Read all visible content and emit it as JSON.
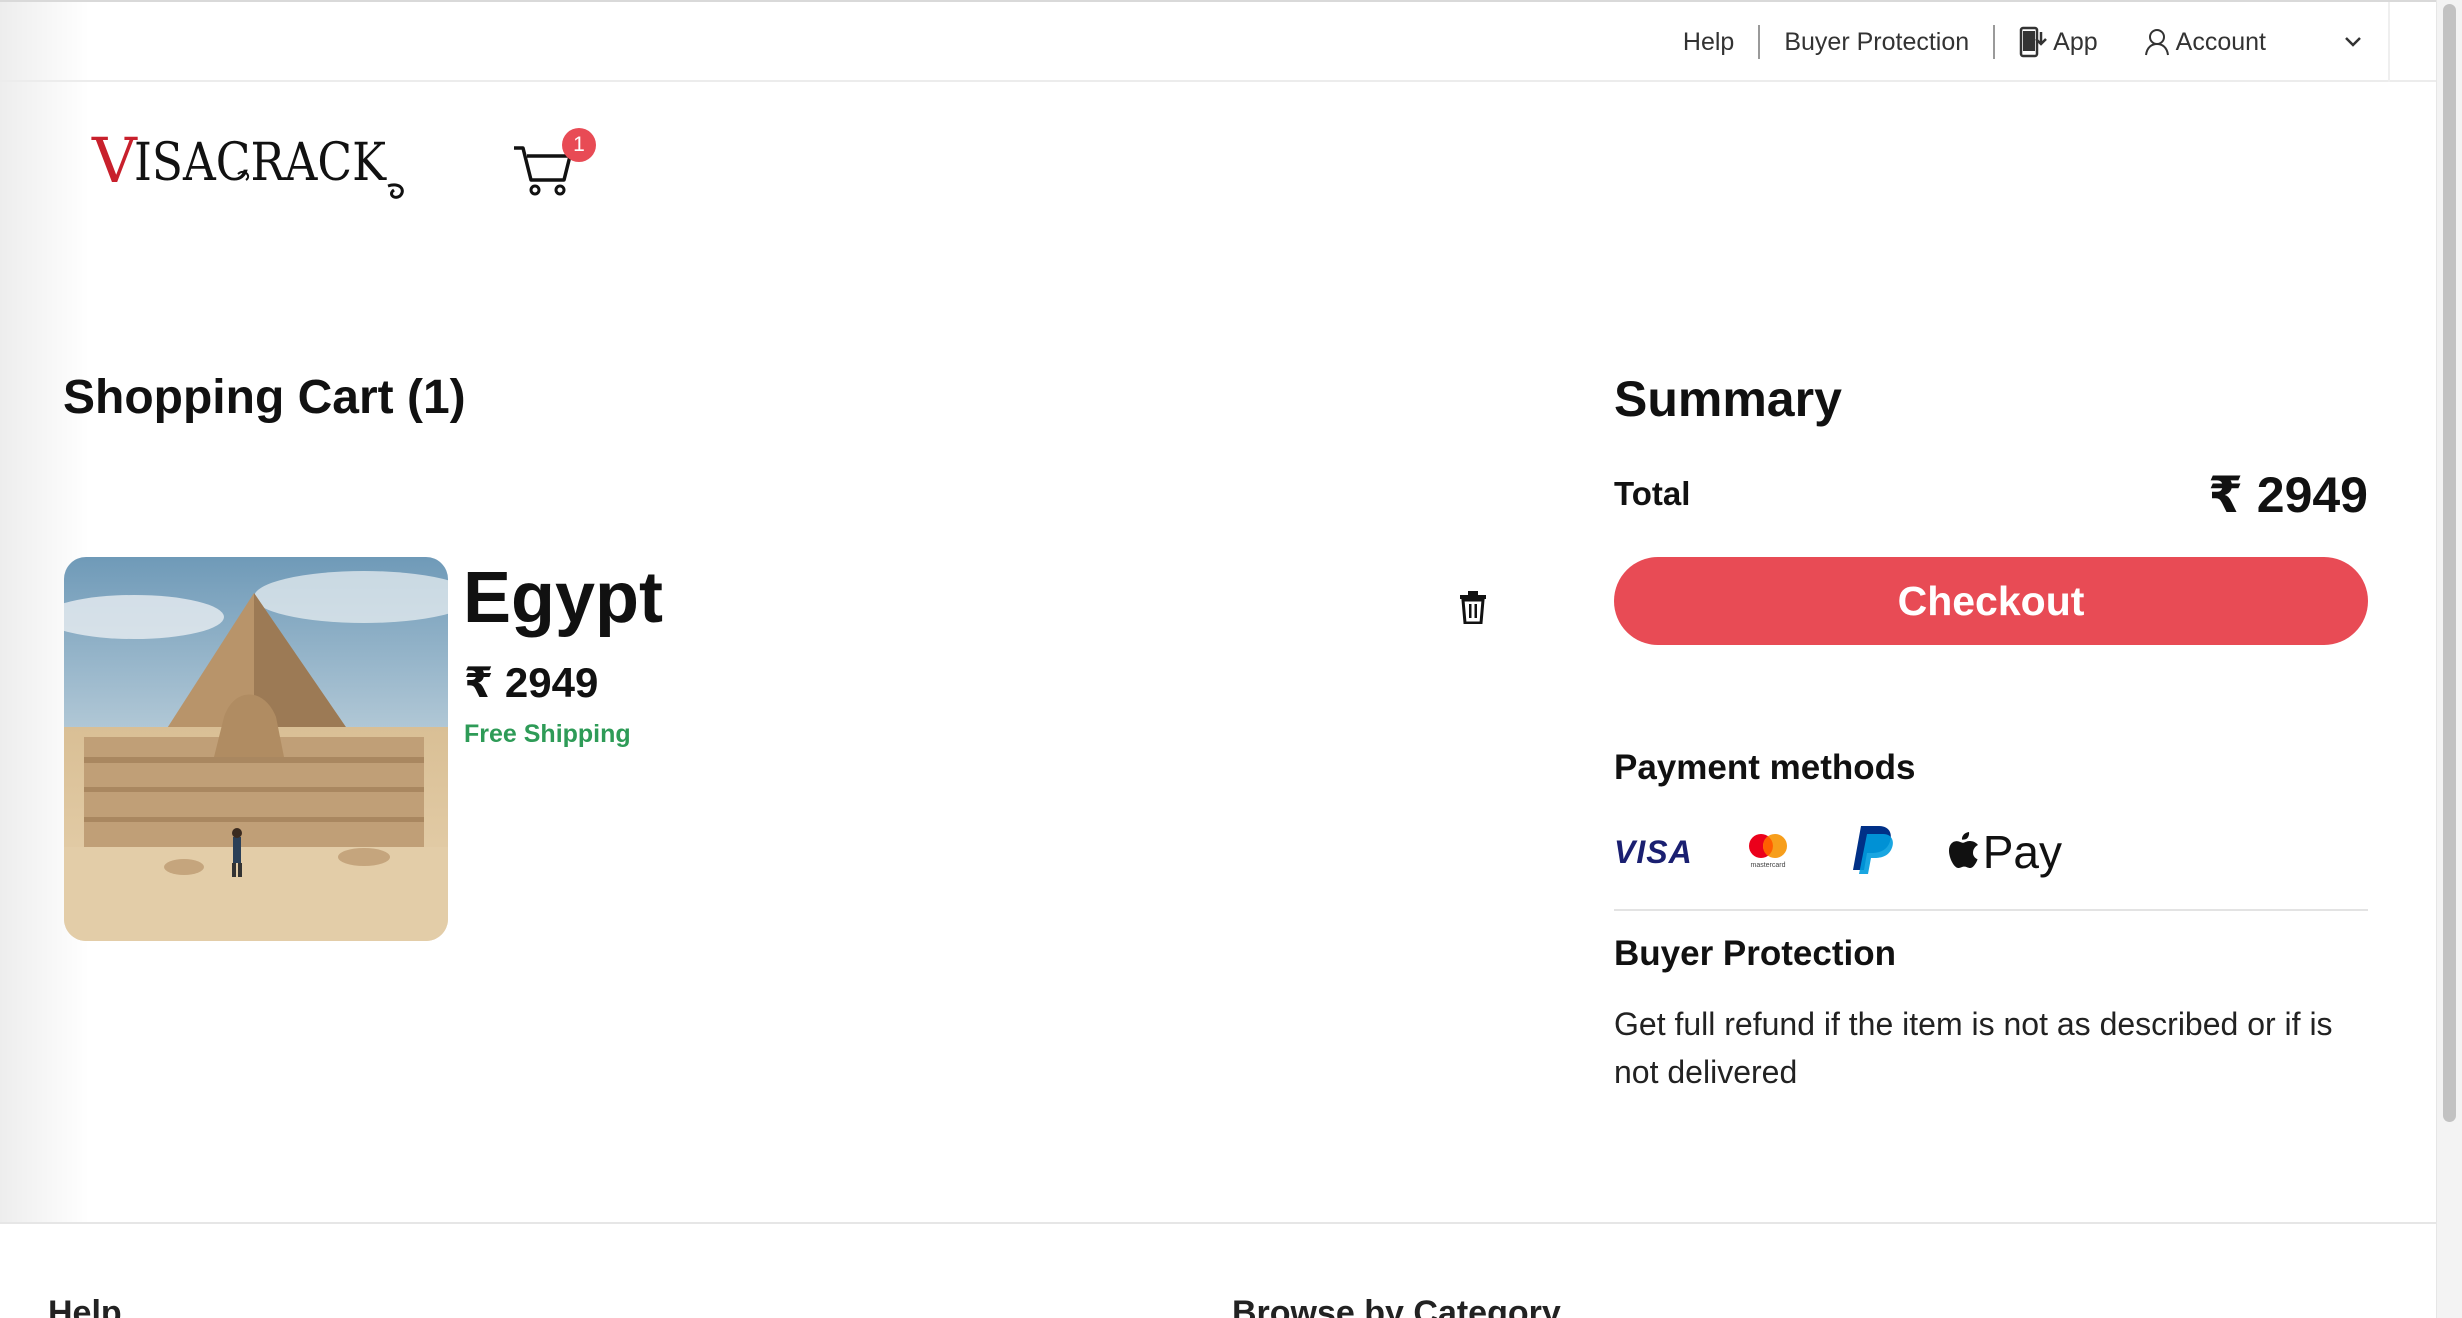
{
  "topbar": {
    "help": "Help",
    "buyer_protection": "Buyer Protection",
    "app": "App",
    "account": "Account"
  },
  "header": {
    "logo_text": "VISACRACK",
    "cart_count": "1"
  },
  "cart": {
    "title": "Shopping Cart (1)",
    "items": [
      {
        "name": "Egypt",
        "price": "₹ 2949",
        "shipping": "Free Shipping",
        "image_icon": "egypt-pyramid-photo"
      }
    ]
  },
  "summary": {
    "title": "Summary",
    "total_label": "Total",
    "total_value": "₹ 2949",
    "checkout_label": "Checkout",
    "payment_methods_title": "Payment methods",
    "payment_methods": [
      "VISA",
      "mastercard",
      "PayPal",
      "Apple Pay"
    ],
    "visa_label": "VISA",
    "mastercard_label": "mastercard",
    "apple_pay_label": "Pay",
    "buyer_protection_title": "Buyer Protection",
    "buyer_protection_text": "Get full refund if the item is not as described or if is not delivered"
  },
  "footer": {
    "help_heading": "Help",
    "browse_heading": "Browse by Category"
  },
  "colors": {
    "accent": "#e84b55",
    "shipping_green": "#2e9b57",
    "visa_blue": "#1a1f71",
    "paypal_blue": "#003087"
  }
}
